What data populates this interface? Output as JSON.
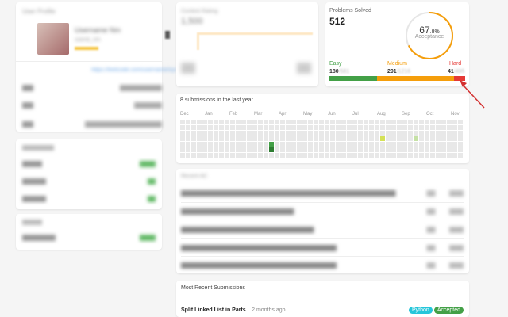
{
  "profile": {
    "section_label": "User Profile",
    "name": "Username Nm",
    "handle": "userid_nm",
    "link": "https://leetcode.com/username/xyz"
  },
  "contest": {
    "title": "Contest Rating",
    "value": "1,500"
  },
  "solved": {
    "title": "Problems Solved",
    "total": "512",
    "pct_int": "67",
    "pct_dec": ".8%",
    "acceptance": "Acceptance",
    "easy": {
      "label": "Easy",
      "solved": "180",
      "total": "/581",
      "fraction": 0.31
    },
    "medium": {
      "label": "Medium",
      "solved": "291",
      "total": "/1216",
      "fraction": 0.24
    },
    "hard": {
      "label": "Hard",
      "solved": "41",
      "total": "/495",
      "fraction": 0.08
    },
    "acceptance_fraction": 0.678
  },
  "calendar": {
    "title": "8 submissions in the last year",
    "months": [
      "Dec",
      "Jan",
      "Feb",
      "Mar",
      "Apr",
      "May",
      "Jun",
      "Jul",
      "Aug",
      "Sep",
      "Oct",
      "Nov"
    ]
  },
  "recent_ac": {
    "title": "Recent AC"
  },
  "recent": {
    "title": "Most Recent Submissions",
    "item": {
      "problem": "Split Linked List in Parts",
      "time": "2 months ago",
      "lang": "Python",
      "status": "Accepted"
    }
  },
  "colors": {
    "easy": "#43a047",
    "medium": "#f59e0b",
    "hard": "#e53935",
    "lang": "#26c6da",
    "accepted": "#43a047"
  }
}
